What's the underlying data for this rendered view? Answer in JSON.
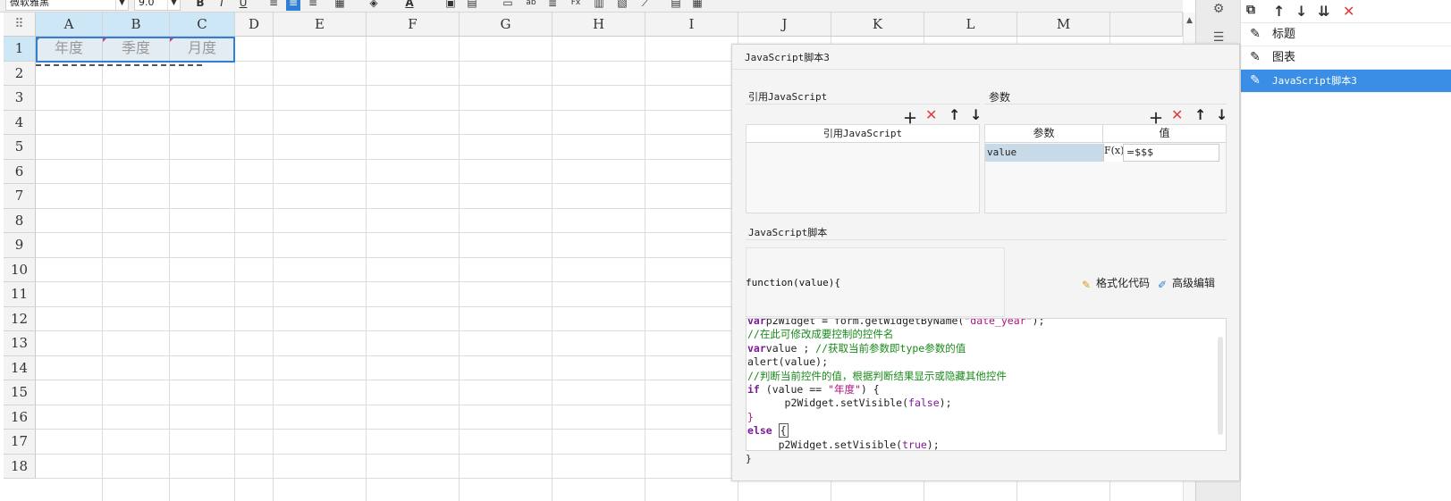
{
  "toolbar": {
    "font_family": "微软雅黑",
    "font_size": "9.0",
    "bold": "B",
    "italic": "I",
    "underline": "U",
    "font_color_label": "A"
  },
  "sheet": {
    "columns": [
      "A",
      "B",
      "C",
      "D",
      "E",
      "F",
      "G",
      "H",
      "I",
      "J",
      "K",
      "L",
      "M"
    ],
    "rows": [
      "1",
      "2",
      "3",
      "4",
      "5",
      "6",
      "7",
      "8",
      "9",
      "10",
      "11",
      "12",
      "13",
      "14",
      "15",
      "16",
      "17",
      "18"
    ],
    "selected_cells": [
      "年度",
      "季度",
      "月度"
    ]
  },
  "right_panel": {
    "items": [
      {
        "label": "标题"
      },
      {
        "label": "图表"
      },
      {
        "label": "JavaScript脚本3"
      }
    ]
  },
  "dialog": {
    "title": "JavaScript脚本3",
    "ref_section_label": "引用JavaScript",
    "ref_table_header": "引用JavaScript",
    "params_section_label": "参数",
    "params_headers": {
      "name": "参数",
      "value": "值"
    },
    "params_rows": [
      {
        "name": "value",
        "fx": "F(x)",
        "value": "=$$$"
      }
    ],
    "script_section_label": "JavaScript脚本",
    "function_signature": "function(value){",
    "format_code_label": "格式化代码",
    "advanced_edit_label": "高级编辑",
    "closing_brace": "}",
    "code_lines": [
      {
        "seg": [
          [
            "kw",
            "var"
          ],
          [
            "",
            "p2Widget = form.getWidgetByName("
          ],
          [
            "str",
            "\"date_year\""
          ],
          [
            "",
            ");"
          ]
        ]
      },
      {
        "seg": [
          [
            "cmt",
            "//在此可修改成要控制的控件名"
          ]
        ]
      },
      {
        "seg": [
          [
            "kw",
            "var"
          ],
          [
            "",
            "value ; "
          ],
          [
            "cmt",
            "//获取当前参数即type参数的值"
          ]
        ]
      },
      {
        "seg": [
          [
            "",
            "alert(value);"
          ]
        ]
      },
      {
        "seg": [
          [
            "cmt",
            "//判断当前控件的值，根据判断结果显示或隐藏其他控件"
          ]
        ]
      },
      {
        "seg": [
          [
            "kw",
            "if"
          ],
          [
            "",
            " (value == "
          ],
          [
            "str",
            "\"年度\""
          ],
          [
            "",
            ") {"
          ]
        ]
      },
      {
        "seg": [
          [
            "",
            "      p2Widget.setVisible("
          ],
          [
            "bool",
            "false"
          ],
          [
            "",
            ");"
          ]
        ]
      },
      {
        "seg": [
          [
            "str",
            "}"
          ]
        ]
      },
      {
        "seg": [
          [
            "kw",
            "else"
          ],
          [
            "",
            " "
          ],
          [
            "cursor",
            "{"
          ]
        ]
      },
      {
        "seg": [
          [
            "",
            "     p2Widget.setVisible("
          ],
          [
            "bool",
            "true"
          ],
          [
            "",
            ");"
          ]
        ]
      }
    ]
  }
}
